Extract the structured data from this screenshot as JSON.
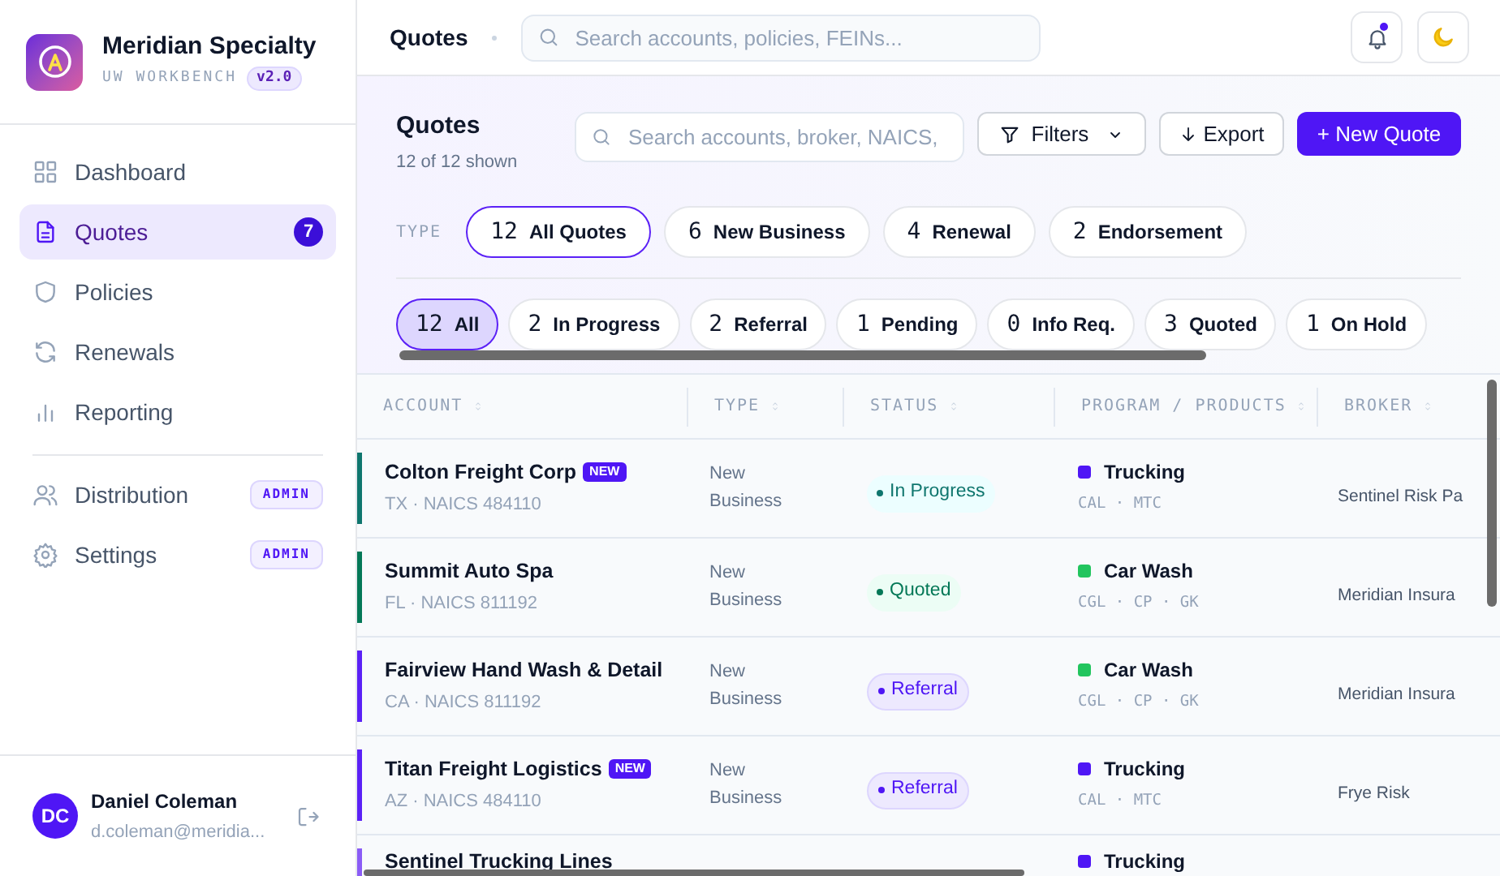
{
  "brand": {
    "name": "Meridian Specialty",
    "subtitle": "UW WORKBENCH",
    "version": "v2.0"
  },
  "nav": [
    {
      "label": "Dashboard",
      "selected": false
    },
    {
      "label": "Quotes",
      "selected": true,
      "count": "7"
    },
    {
      "label": "Policies",
      "selected": false
    },
    {
      "label": "Renewals",
      "selected": false
    },
    {
      "label": "Reporting",
      "selected": false
    }
  ],
  "admin_nav": [
    {
      "label": "Distribution",
      "selected": false,
      "badge": "ADMIN"
    },
    {
      "label": "Settings",
      "selected": false,
      "badge": "ADMIN"
    }
  ],
  "user": {
    "initials": "DC",
    "name": "Daniel Coleman",
    "email": "d.coleman@meridia..."
  },
  "topbar": {
    "title": "Quotes",
    "search_placeholder": "Search accounts, policies, FEINs...",
    "notification": true
  },
  "page": {
    "title": "Quotes",
    "subtitle": "12 of 12 shown",
    "search_placeholder": "Search accounts, broker, NAICS,",
    "filters": "Filters",
    "export": "Export",
    "new_quote": "+ New Quote"
  },
  "type_filter": {
    "label": "TYPE",
    "chips": [
      {
        "count": "12",
        "label": "All Quotes",
        "selected": true
      },
      {
        "count": "6",
        "label": "New Business",
        "selected": false
      },
      {
        "count": "4",
        "label": "Renewal",
        "selected": false
      },
      {
        "count": "2",
        "label": "Endorsement",
        "selected": false
      }
    ]
  },
  "status_filter": [
    {
      "count": "12",
      "label": "All",
      "selected": true
    },
    {
      "count": "2",
      "label": "In Progress",
      "selected": false
    },
    {
      "count": "2",
      "label": "Referral",
      "selected": false
    },
    {
      "count": "1",
      "label": "Pending",
      "selected": false
    },
    {
      "count": "0",
      "label": "Info Req.",
      "selected": false
    },
    {
      "count": "3",
      "label": "Quoted",
      "selected": false
    },
    {
      "count": "1",
      "label": "On Hold",
      "selected": false
    }
  ],
  "table": {
    "columns": [
      "ACCOUNT",
      "TYPE",
      "STATUS",
      "PROGRAM / PRODUCTS",
      "BROKER"
    ],
    "rows": [
      {
        "color": "#0f766e",
        "account": "Colton Freight Corp",
        "badge": "NEW",
        "location": "TX · NAICS 484110",
        "type": "New Business",
        "status": {
          "label": "In Progress",
          "kind": "progress"
        },
        "program": {
          "name": "Trucking",
          "color": "#4f16f5",
          "products": "CAL · MTC"
        },
        "broker": "Sentinel Risk Pa"
      },
      {
        "color": "#047857",
        "account": "Summit Auto Spa",
        "location": "FL · NAICS 811192",
        "type": "New Business",
        "status": {
          "label": "Quoted",
          "kind": "quoted"
        },
        "program": {
          "name": "Car Wash",
          "color": "#22c55e",
          "products": "CGL · CP · GK"
        },
        "broker": "Meridian Insura"
      },
      {
        "color": "#5b21f6",
        "account": "Fairview Hand Wash & Detail",
        "location": "CA · NAICS 811192",
        "type": "New Business",
        "status": {
          "label": "Referral",
          "kind": "referral"
        },
        "program": {
          "name": "Car Wash",
          "color": "#22c55e",
          "products": "CGL · CP · GK"
        },
        "broker": "Meridian Insura"
      },
      {
        "color": "#5b21f6",
        "account": "Titan Freight Logistics",
        "badge": "NEW",
        "location": "AZ · NAICS 484110",
        "type": "New Business",
        "status": {
          "label": "Referral",
          "kind": "referral"
        },
        "program": {
          "name": "Trucking",
          "color": "#4f16f5",
          "products": "CAL · MTC"
        },
        "broker": "Frye Risk"
      },
      {
        "color": "#8b5cf6",
        "account": "Sentinel Trucking Lines",
        "program": {
          "name": "Trucking",
          "color": "#4f16f5"
        }
      }
    ]
  }
}
